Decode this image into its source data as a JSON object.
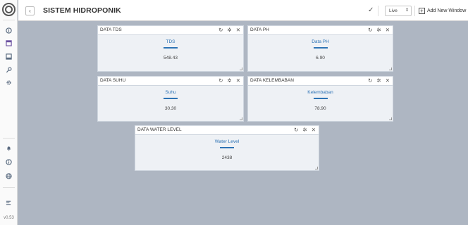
{
  "header": {
    "title": "SISTEM HIDROPONIK",
    "back_icon": "‹",
    "check_icon": "✓",
    "live_value": "Live",
    "live_arrow": "⇕",
    "add_window_label": "Add New Window",
    "add_icon": "+"
  },
  "sidebar": {
    "version": "v0.53",
    "icons": [
      "info-icon",
      "dashboard-icon",
      "panel-icon",
      "key-icon",
      "gear-icon",
      "bell-icon",
      "info-circle-icon",
      "globe-icon",
      "collapse-icon"
    ]
  },
  "widget_controls": {
    "refresh": "↻",
    "settings": "✲",
    "close": "✕"
  },
  "widgets": [
    {
      "title": "DATA TDS",
      "label": "TDS",
      "value": "548.43"
    },
    {
      "title": "DATA PH",
      "label": "Data PH",
      "value": "6.90"
    },
    {
      "title": "DATA SUHU",
      "label": "Suhu",
      "value": "30.30"
    },
    {
      "title": "DATA KELEMBABAN",
      "label": "Kelembaban",
      "value": "78.90"
    },
    {
      "title": "DATA WATER LEVEL",
      "label": "Water Level",
      "value": "2438"
    }
  ],
  "colors": {
    "accent": "#2d73b5",
    "canvas": "#aeb6c2"
  }
}
